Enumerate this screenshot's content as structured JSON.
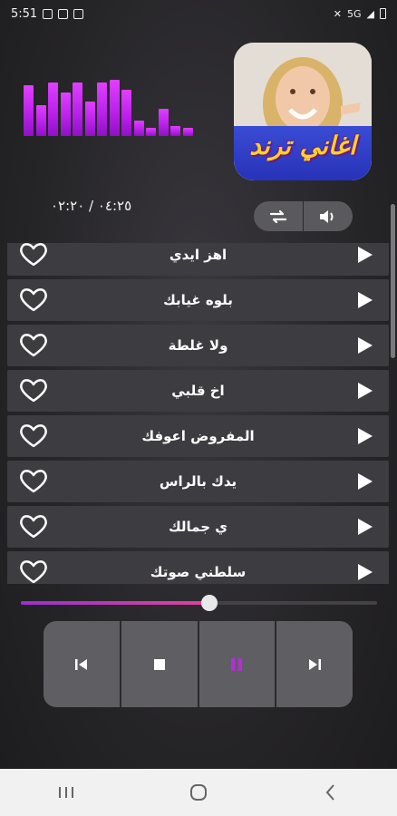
{
  "status_bar": {
    "time": "5:51",
    "network_label": "5G"
  },
  "player": {
    "time_display": "٠٤:٢٥ / ٠٢:٢٠",
    "album_title": "اغاني ترند",
    "progress_fraction": 0.53,
    "equalizer_levels": [
      0.9,
      0.55,
      0.95,
      0.78,
      0.95,
      0.62,
      0.95,
      1.0,
      0.82,
      0.28,
      0.15,
      0.48,
      0.18,
      0.15
    ],
    "accent_color": "#b81fe8",
    "pause_icon_color": "#b62be0"
  },
  "playlist": {
    "items": [
      {
        "title": "اهز ايدي"
      },
      {
        "title": "بلوه غيابك"
      },
      {
        "title": "ولا غلطة"
      },
      {
        "title": "اخ قلبي"
      },
      {
        "title": "المفروض اعوفك"
      },
      {
        "title": "يدك بالراس"
      },
      {
        "title": "ي جمالك"
      },
      {
        "title": "سلطني صوتك"
      }
    ]
  },
  "icons": {
    "repeat": "repeat-icon",
    "volume": "volume-icon",
    "favorite": "heart-icon",
    "play": "play-icon",
    "previous": "skip-previous-icon",
    "stop": "stop-icon",
    "pause": "pause-icon",
    "next": "skip-next-icon"
  }
}
